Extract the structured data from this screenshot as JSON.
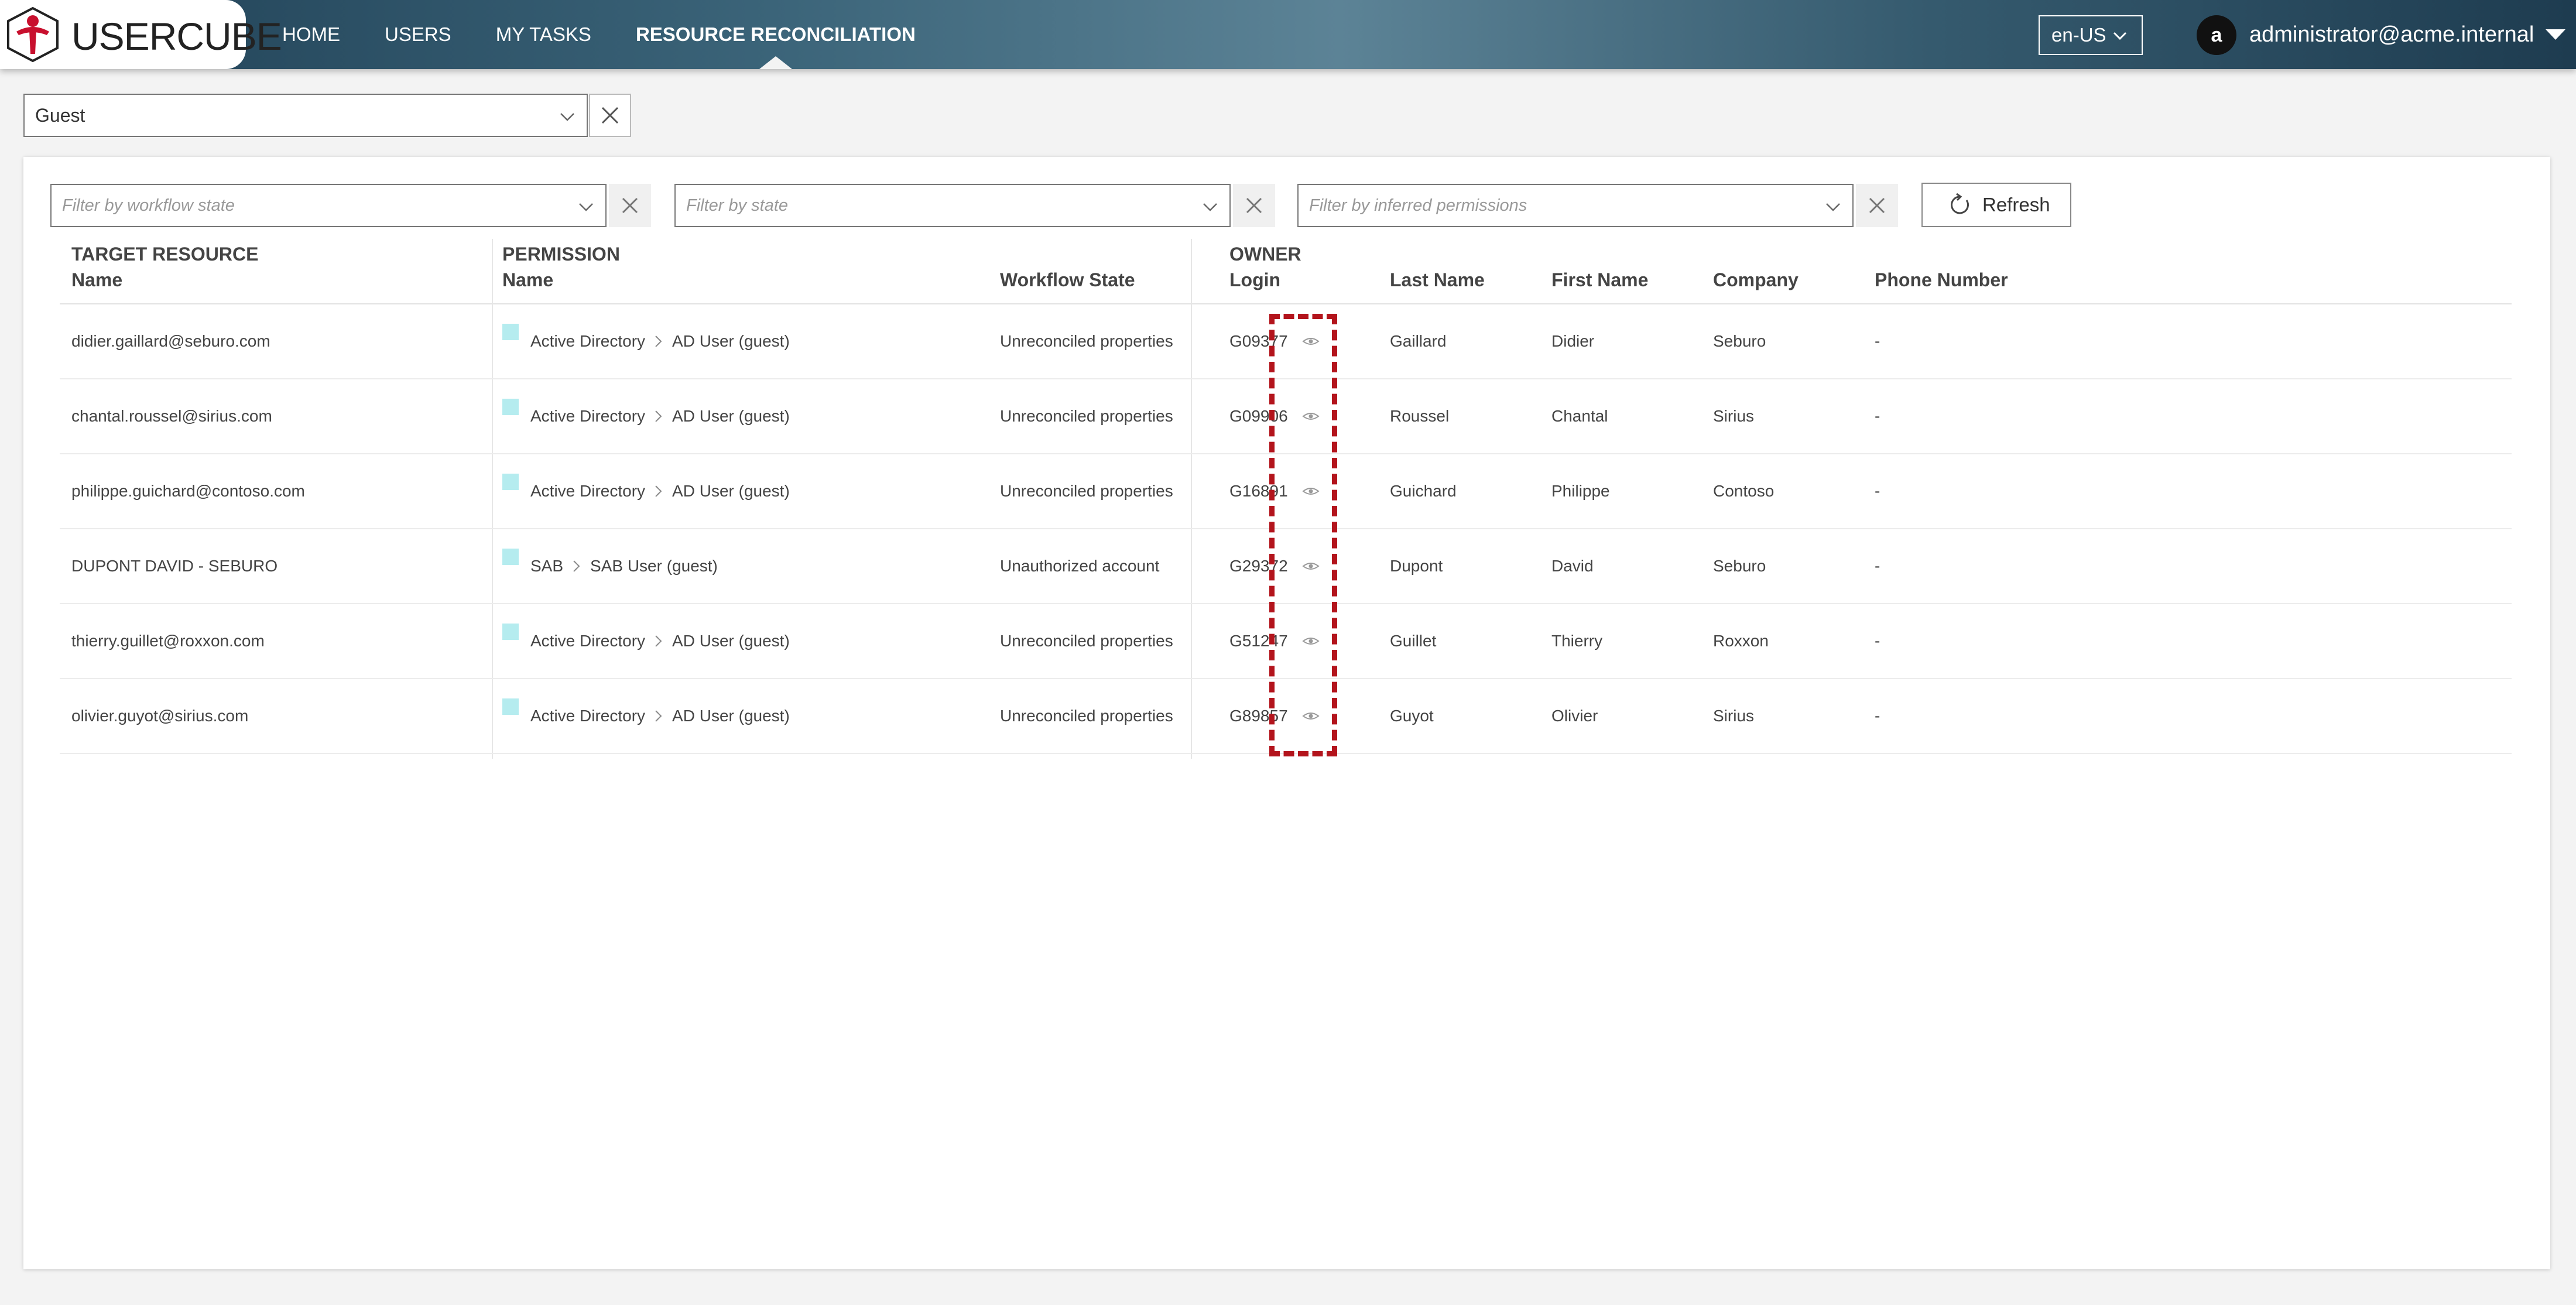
{
  "app": {
    "logo_text": "USERCUBE",
    "nav": [
      "HOME",
      "USERS",
      "MY TASKS",
      "RESOURCE RECONCILIATION"
    ],
    "active_nav": "RESOURCE RECONCILIATION",
    "language": "en-US",
    "user_initial": "a",
    "user_name": "administrator@acme.internal"
  },
  "resource_type": {
    "value": "Guest"
  },
  "filters": {
    "workflow_state_placeholder": "Filter by workflow state",
    "state_placeholder": "Filter by state",
    "inferred_permissions_placeholder": "Filter by inferred permissions",
    "refresh_label": "Refresh"
  },
  "table": {
    "group_headers": {
      "target_resource": "TARGET RESOURCE",
      "permission": "PERMISSION",
      "owner": "OWNER"
    },
    "columns": {
      "name": "Name",
      "permission_name": "Name",
      "workflow_state": "Workflow State",
      "login": "Login",
      "last_name": "Last Name",
      "first_name": "First Name",
      "company": "Company",
      "phone": "Phone Number"
    },
    "rows": [
      {
        "name": "didier.gaillard@seburo.com",
        "perm_system": "Active Directory",
        "perm_name": "AD User (guest)",
        "workflow_state": "Unreconciled properties",
        "login": "G09377",
        "last_name": "Gaillard",
        "first_name": "Didier",
        "company": "Seburo",
        "phone": "-"
      },
      {
        "name": "chantal.roussel@sirius.com",
        "perm_system": "Active Directory",
        "perm_name": "AD User (guest)",
        "workflow_state": "Unreconciled properties",
        "login": "G09906",
        "last_name": "Roussel",
        "first_name": "Chantal",
        "company": "Sirius",
        "phone": "-"
      },
      {
        "name": "philippe.guichard@contoso.com",
        "perm_system": "Active Directory",
        "perm_name": "AD User (guest)",
        "workflow_state": "Unreconciled properties",
        "login": "G16891",
        "last_name": "Guichard",
        "first_name": "Philippe",
        "company": "Contoso",
        "phone": "-"
      },
      {
        "name": "DUPONT DAVID - SEBURO",
        "perm_system": "SAB",
        "perm_name": "SAB User (guest)",
        "workflow_state": "Unauthorized account",
        "login": "G29372",
        "last_name": "Dupont",
        "first_name": "David",
        "company": "Seburo",
        "phone": "-"
      },
      {
        "name": "thierry.guillet@roxxon.com",
        "perm_system": "Active Directory",
        "perm_name": "AD User (guest)",
        "workflow_state": "Unreconciled properties",
        "login": "G51247",
        "last_name": "Guillet",
        "first_name": "Thierry",
        "company": "Roxxon",
        "phone": "-"
      },
      {
        "name": "olivier.guyot@sirius.com",
        "perm_system": "Active Directory",
        "perm_name": "AD User (guest)",
        "workflow_state": "Unreconciled properties",
        "login": "G89857",
        "last_name": "Guyot",
        "first_name": "Olivier",
        "company": "Sirius",
        "phone": "-"
      }
    ]
  },
  "colors": {
    "highlight": "#b3141c",
    "permission_swatch": "#b5ecef",
    "logo_red": "#c8102e"
  }
}
